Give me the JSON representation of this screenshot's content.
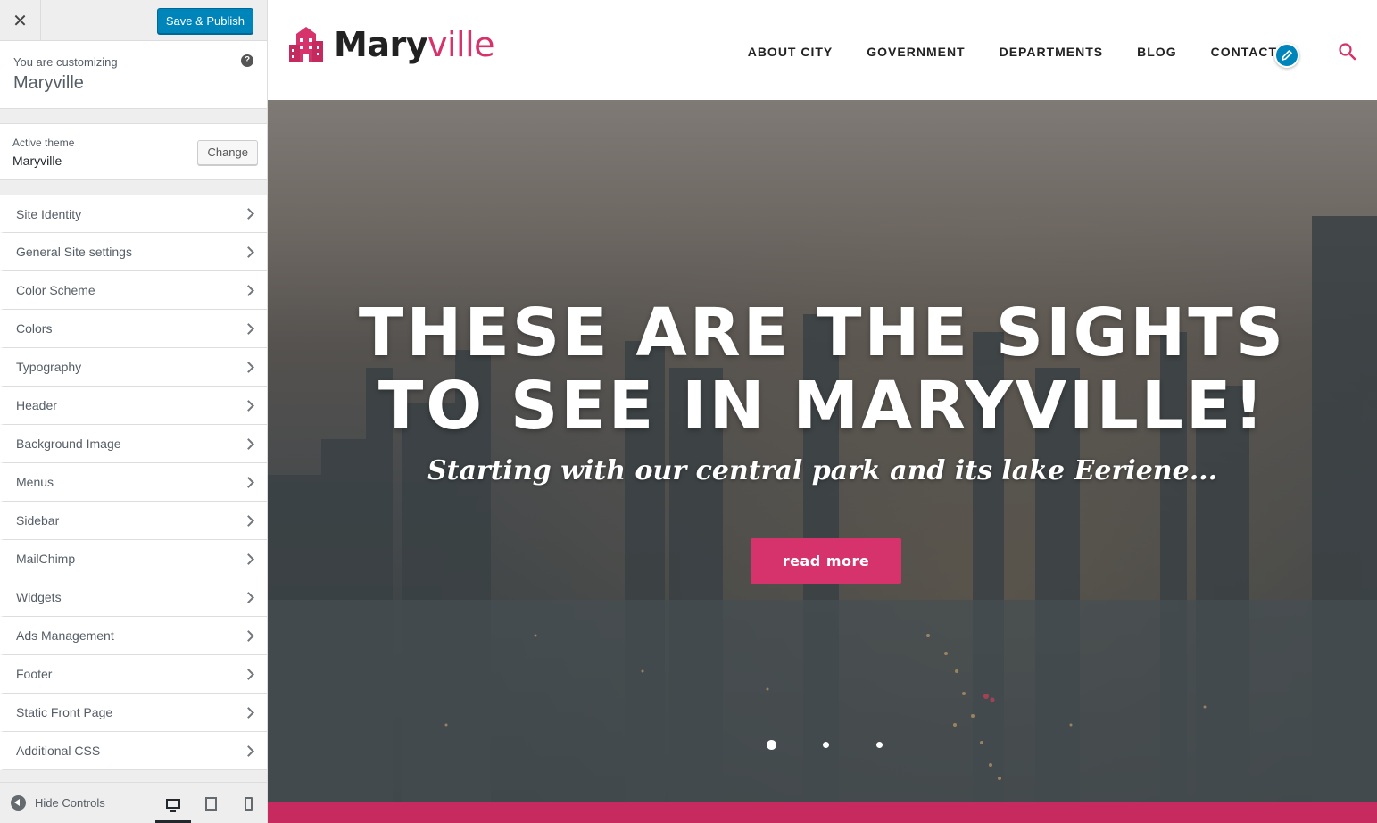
{
  "customizer": {
    "close_icon": "close-icon",
    "save_label": "Save & Publish",
    "customizing_label": "You are customizing",
    "site_name": "Maryville",
    "help_glyph": "?",
    "active_theme_label": "Active theme",
    "active_theme_name": "Maryville",
    "change_label": "Change",
    "sections": [
      {
        "label": "Site Identity"
      },
      {
        "label": "General Site settings"
      },
      {
        "label": "Color Scheme"
      },
      {
        "label": "Colors"
      },
      {
        "label": "Typography"
      },
      {
        "label": "Header"
      },
      {
        "label": "Background Image"
      },
      {
        "label": "Menus"
      },
      {
        "label": "Sidebar"
      },
      {
        "label": "MailChimp"
      },
      {
        "label": "Widgets"
      },
      {
        "label": "Ads Management"
      },
      {
        "label": "Footer"
      },
      {
        "label": "Static Front Page"
      },
      {
        "label": "Additional CSS"
      }
    ],
    "hide_controls_label": "Hide Controls",
    "devices": [
      "desktop",
      "tablet",
      "mobile"
    ],
    "active_device": "desktop"
  },
  "site": {
    "logo_dark": "Mary",
    "logo_pink": "ville",
    "nav": [
      "ABOUT CITY",
      "GOVERNMENT",
      "DEPARTMENTS",
      "BLOG",
      "CONTACT"
    ],
    "hero": {
      "title_line1": "THESE ARE THE SIGHTS",
      "title_line2": "TO SEE IN MARYVILLE!",
      "subtitle": "Starting with our central park and its lake Eeriene...",
      "button_label": "read more",
      "slides": 3,
      "active_slide": 1
    }
  },
  "colors": {
    "accent": "#d6336c",
    "primary_button": "#0085ba",
    "sidebar_bg": "#eeeeee"
  }
}
